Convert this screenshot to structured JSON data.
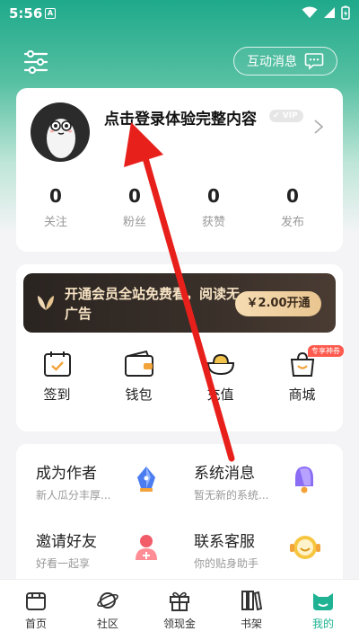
{
  "status_bar": {
    "time": "5:56",
    "app_badge": "A"
  },
  "header": {
    "message_button_label": "互动消息"
  },
  "profile": {
    "login_prompt": "点击登录体验完整内容",
    "vip_badge": "VIP",
    "stats": [
      {
        "value": "0",
        "label": "关注"
      },
      {
        "value": "0",
        "label": "粉丝"
      },
      {
        "value": "0",
        "label": "获赞"
      },
      {
        "value": "0",
        "label": "发布"
      }
    ]
  },
  "vip_promo": {
    "text": "开通会员全站免费看，阅读无广告",
    "button_label": "￥2.00开通"
  },
  "shortcuts": [
    {
      "label": "签到",
      "icon": "calendar-check-icon"
    },
    {
      "label": "钱包",
      "icon": "wallet-icon"
    },
    {
      "label": "充值",
      "icon": "gold-ingot-icon"
    },
    {
      "label": "商城",
      "icon": "shop-icon",
      "badge": "专享神券"
    }
  ],
  "services": [
    {
      "title": "成为作者",
      "subtitle": "新人瓜分丰厚...",
      "icon": "pen-nib-icon"
    },
    {
      "title": "系统消息",
      "subtitle": "暂无新的系统...",
      "icon": "bell-icon"
    },
    {
      "title": "邀请好友",
      "subtitle": "好看一起享",
      "icon": "add-user-icon"
    },
    {
      "title": "联系客服",
      "subtitle": "你的贴身助手",
      "icon": "headset-smiley-icon"
    }
  ],
  "tabs": [
    {
      "label": "首页",
      "icon": "home-icon"
    },
    {
      "label": "社区",
      "icon": "planet-icon"
    },
    {
      "label": "领现金",
      "icon": "gift-icon"
    },
    {
      "label": "书架",
      "icon": "bookshelf-icon"
    },
    {
      "label": "我的",
      "icon": "mine-cat-icon",
      "active": true
    }
  ],
  "colors": {
    "accent": "#1fb393",
    "header_green": "#1fa98b",
    "annotation_red": "#e8201c",
    "vip_gold": "#e9c590"
  }
}
